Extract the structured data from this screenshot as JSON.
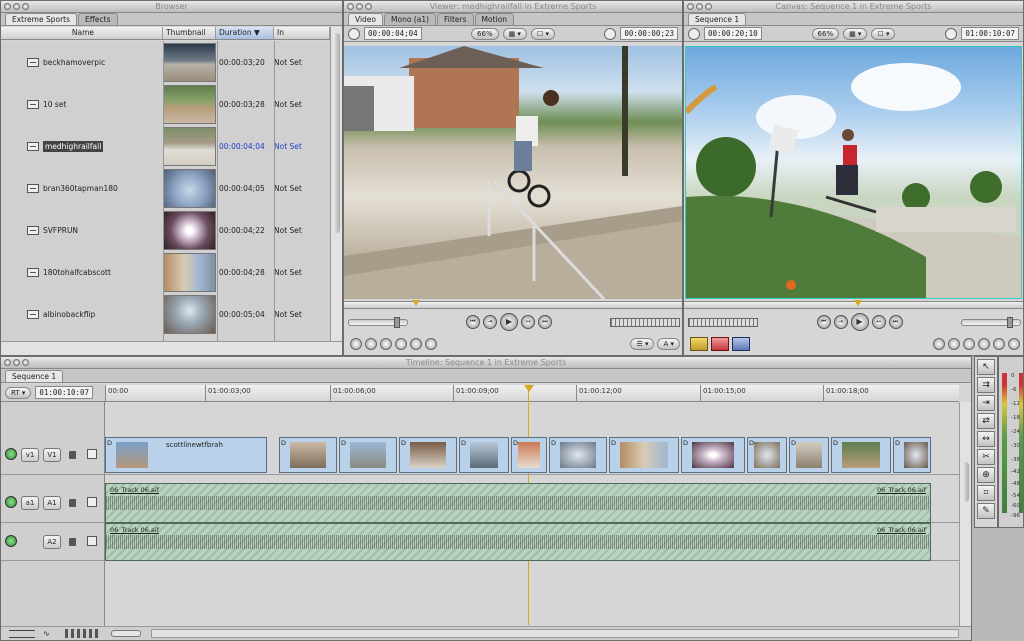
{
  "browser": {
    "title": "Browser",
    "tabs": [
      "Extreme Sports",
      "Effects"
    ],
    "columns": [
      "Name",
      "Thumbnail",
      "Duration",
      "In"
    ],
    "clips": [
      {
        "name": "beckhamoverpic",
        "duration": "00:00:03;20",
        "in": "Not Set"
      },
      {
        "name": "10 set",
        "duration": "00:00:03;28",
        "in": "Not Set"
      },
      {
        "name": "medhighrailfall",
        "duration": "00:00:04;04",
        "in": "Not Set",
        "selected": true
      },
      {
        "name": "bran360tapman180",
        "duration": "00:00:04;05",
        "in": "Not Set"
      },
      {
        "name": "SVFPRUN",
        "duration": "00:00:04;22",
        "in": "Not Set"
      },
      {
        "name": "180tohalfcabscott",
        "duration": "00:00:04;28",
        "in": "Not Set"
      },
      {
        "name": "albinobackflip",
        "duration": "00:00:05;04",
        "in": "Not Set"
      }
    ]
  },
  "viewer": {
    "title": "Viewer: medhighrailfall in Extreme Sports",
    "tabs": [
      "Video",
      "Mono (a1)",
      "Filters",
      "Motion"
    ],
    "timecode_left": "00:00:04;04",
    "zoom": "66%",
    "timecode_right": "00:00:00;23"
  },
  "canvas": {
    "title": "Canvas: Sequence 1 in Extreme Sports",
    "tabs": [
      "Sequence 1"
    ],
    "timecode_left": "00:00:20;10",
    "zoom": "66%",
    "timecode_right": "01:00:10:07"
  },
  "timeline": {
    "title": "Timeline: Sequence 1 in Extreme Sports",
    "tab": "Sequence 1",
    "rt": "RT",
    "timecode": "01:00:10:07",
    "ruler": [
      "00:00",
      "01:00:03;00",
      "01:00:06;00",
      "01:00:09;00",
      "01:00:12;00",
      "01:00:15;00",
      "01:00:18;00"
    ],
    "video_track": {
      "patch": "v1",
      "dest": "V1",
      "main_clip": "scottlinewtfbrah",
      "clip_marker": "D"
    },
    "audio_tracks": [
      {
        "patch": "a1",
        "dest": "A1",
        "clip_start": "06_Track 06.aif",
        "clip_end": "06_Track 06.aif"
      },
      {
        "patch": "",
        "dest": "A2",
        "clip_start": "06_Track 06.aif",
        "clip_end": "06_Track 06.aif"
      }
    ]
  },
  "tools": [
    "arrow-tool",
    "select-track-tool",
    "edit-tool",
    "ripple-tool",
    "slip-tool",
    "razor-tool",
    "zoom-tool",
    "crop-tool",
    "pen-tool"
  ],
  "meters": [
    "0",
    "-6",
    "-12",
    "-18",
    "-24",
    "-30",
    "-36",
    "-42",
    "-48",
    "-54",
    "-60",
    "-96"
  ]
}
